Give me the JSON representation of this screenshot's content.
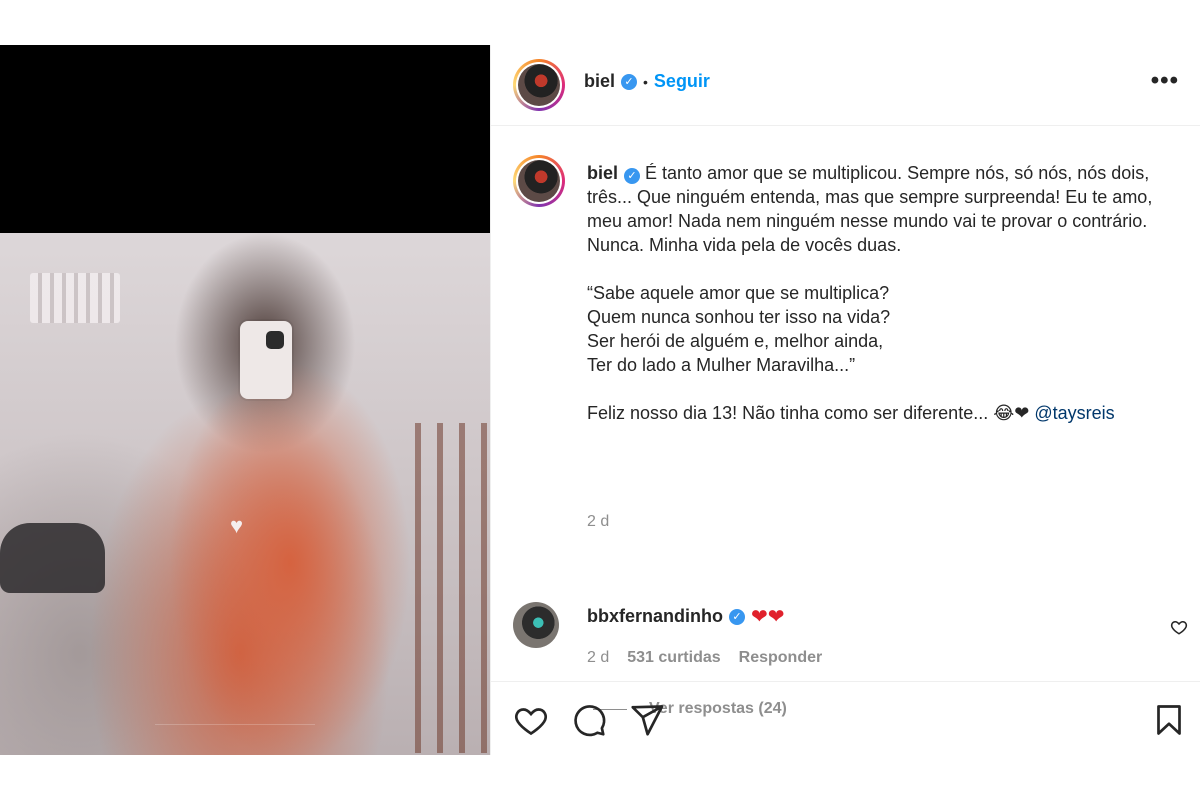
{
  "post": {
    "author": "biel",
    "follow_label": "Seguir",
    "separator": "•",
    "more_label": "•••",
    "caption": {
      "p1": "É tanto amor que se multiplicou. Sempre nós, só nós, nós dois, três... Que ninguém entenda, mas que sempre surpreenda! Eu te amo, meu amor! Nada nem ninguém nesse mundo vai te provar o contrário. Nunca. Minha vida pela de vocês duas.",
      "quote_l1": "“Sabe aquele amor que se multiplica?",
      "quote_l2": "Quem nunca sonhou ter isso na vida?",
      "quote_l3": "Ser herói de alguém e, melhor ainda,",
      "quote_l4": "Ter do lado a Mulher Maravilha...”",
      "p3": "Feliz nosso dia 13! Não tinha como ser diferente...",
      "emojis": "😂❤",
      "mention": "@taysreis"
    },
    "time": "2 d",
    "comment": {
      "author": "bbxfernandinho",
      "text": "❤❤",
      "time": "2 d",
      "likes": "531 curtidas",
      "reply_label": "Responder",
      "view_replies": "Ver respostas (24)"
    },
    "icons": {
      "like": "heart-outline-icon",
      "comment": "comment-bubble-icon",
      "share": "paper-plane-icon",
      "save": "bookmark-icon",
      "verified": "verified-badge-icon"
    },
    "colors": {
      "follow": "#0095f6",
      "verified": "#3897f0",
      "secondary_text": "#8e8e8e",
      "mention": "#00376b"
    }
  }
}
